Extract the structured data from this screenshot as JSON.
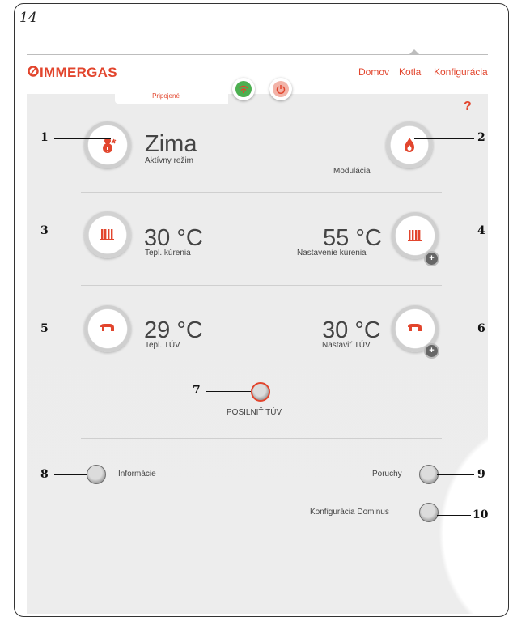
{
  "page_number": "14",
  "logo_text": "IMMERGAS",
  "nav": [
    "Domov",
    "Kotla",
    "Konfigurácia"
  ],
  "tab_label": "Pripojené",
  "help_symbol": "?",
  "mode": {
    "value": "Zima",
    "label": "Aktívny režim",
    "icon": "snowman-icon"
  },
  "modulation": {
    "label": "Modulácia",
    "icon": "flame-icon"
  },
  "heating_temp": {
    "value": "30 °C",
    "label": "Tepl. kúrenia",
    "icon": "radiator-icon"
  },
  "heating_setpoint": {
    "value": "55 °C",
    "label": "Nastavenie kúrenia",
    "icon": "radiator-icon"
  },
  "dhw_temp": {
    "value": "29 °C",
    "label": "Tepl. TÚV",
    "icon": "tap-icon"
  },
  "dhw_setpoint": {
    "value": "30 °C",
    "label": "Nastaviť TÚV",
    "icon": "tap-icon"
  },
  "boost": {
    "label": "POSILNIŤ TÚV"
  },
  "info": {
    "label": "Informácie"
  },
  "faults": {
    "label": "Poruchy"
  },
  "dominus": {
    "label": "Konfigurácia Dominus"
  },
  "callouts": [
    "1",
    "2",
    "3",
    "4",
    "5",
    "6",
    "7",
    "8",
    "9",
    "10"
  ],
  "colors": {
    "accent": "#e2452d",
    "panel": "#ececec",
    "wifi": "#4caf50"
  }
}
